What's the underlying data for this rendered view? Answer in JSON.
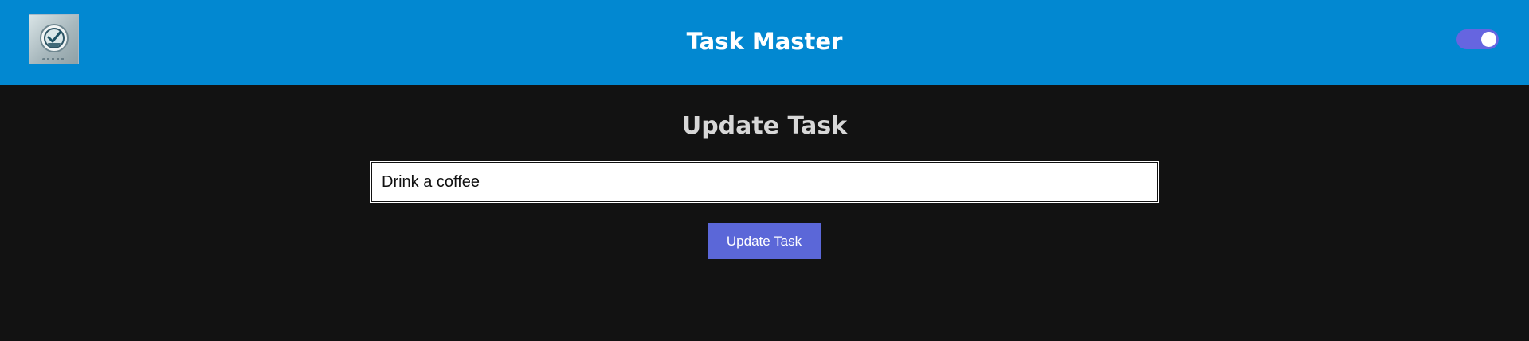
{
  "header": {
    "title": "Task Master",
    "logo_icon": "task-check-logo-icon",
    "theme_toggle": {
      "state": "on",
      "icon": "toggle-switch-icon",
      "color": "#6665e0"
    }
  },
  "main": {
    "heading": "Update Task",
    "task_input": {
      "value": "Drink a coffee",
      "placeholder": ""
    },
    "update_button_label": "Update Task"
  },
  "colors": {
    "header_background": "#0288d1",
    "page_background": "#121212",
    "title_text": "#ffffff",
    "heading_text": "#d7d7d7",
    "button_background": "#5b67d8",
    "input_background": "#ffffff"
  }
}
